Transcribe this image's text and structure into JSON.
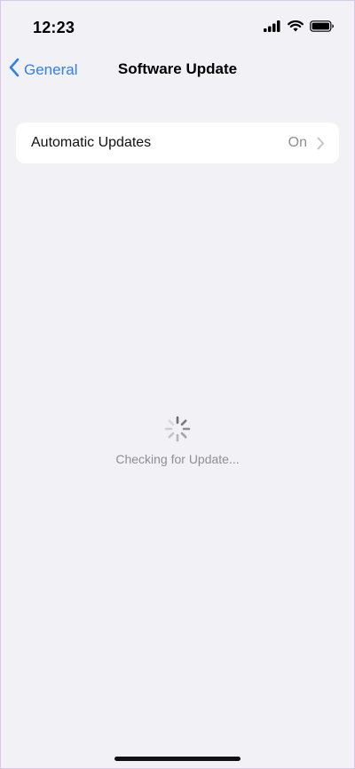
{
  "status_bar": {
    "time": "12:23"
  },
  "nav": {
    "back_label": "General",
    "title": "Software Update"
  },
  "settings": {
    "automatic_updates_label": "Automatic Updates",
    "automatic_updates_value": "On"
  },
  "status": {
    "checking_text": "Checking for Update..."
  },
  "colors": {
    "accent": "#2f80ed",
    "background": "#f2f1f6",
    "secondary_text": "#8e8e93"
  },
  "icons": {
    "signal": "cellular-signal-icon",
    "wifi": "wifi-icon",
    "battery": "battery-icon",
    "back": "chevron-left-icon",
    "row": "chevron-right-icon",
    "loading": "spinner-icon"
  }
}
